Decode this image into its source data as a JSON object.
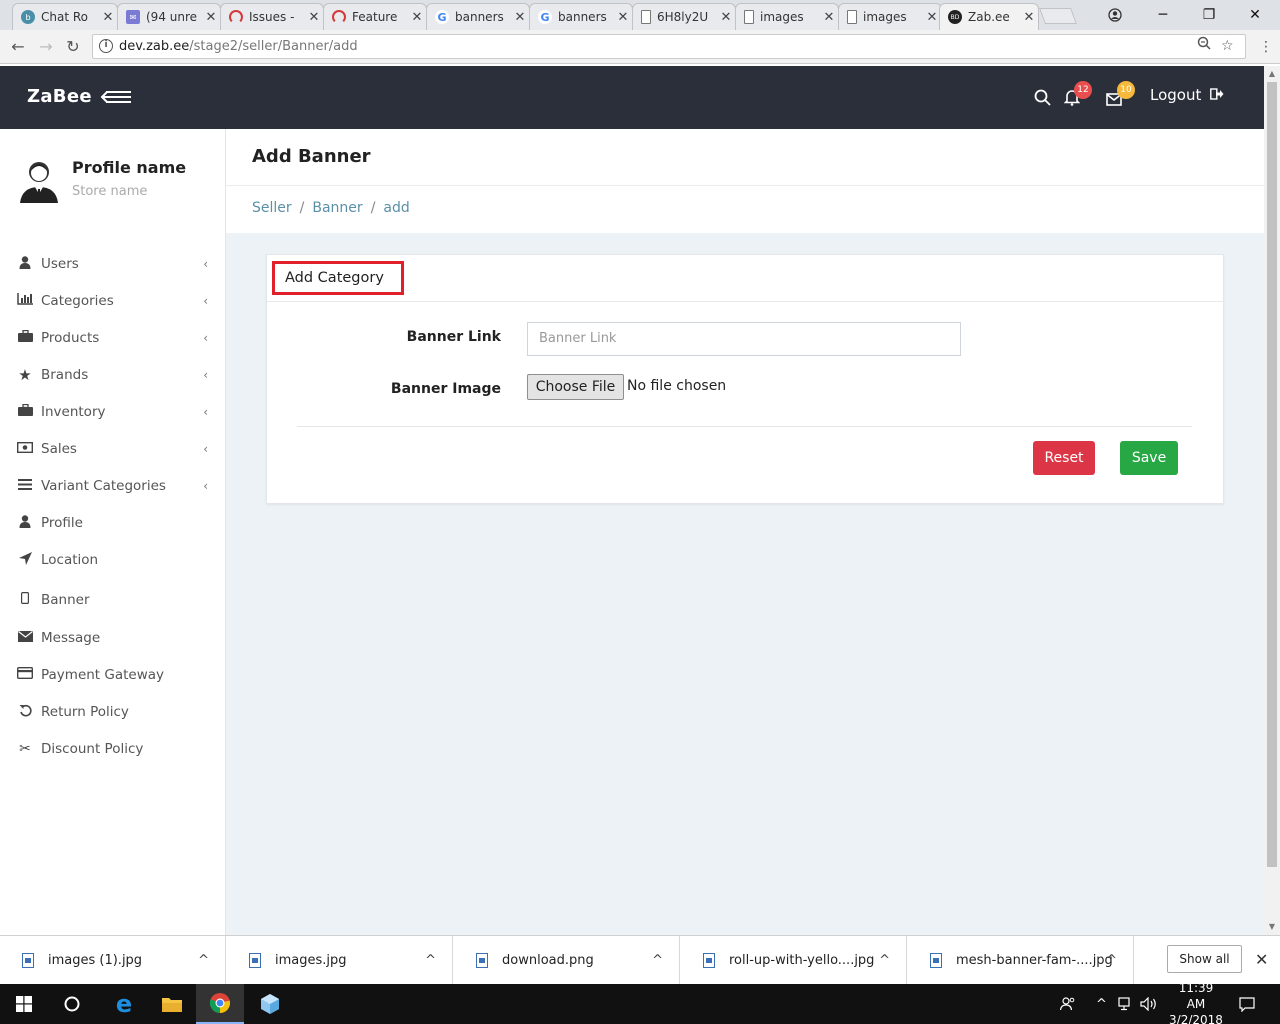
{
  "browser": {
    "tabs": [
      {
        "label": "Chat Ro",
        "icon": "chat-icon"
      },
      {
        "label": "(94 unre",
        "icon": "mail-icon"
      },
      {
        "label": "Issues -",
        "icon": "issues-icon"
      },
      {
        "label": "Feature",
        "icon": "feature-icon"
      },
      {
        "label": "banners",
        "icon": "google-icon"
      },
      {
        "label": "banners",
        "icon": "google-icon"
      },
      {
        "label": "6H8ly2U",
        "icon": "document-icon"
      },
      {
        "label": "images",
        "icon": "document-icon"
      },
      {
        "label": "images",
        "icon": "document-icon"
      },
      {
        "label": "Zab.ee",
        "icon": "zabee-icon"
      }
    ],
    "url_host": "dev.zab.ee",
    "url_path": "/stage2/seller/Banner/add"
  },
  "header": {
    "logo": "ZaBee",
    "notifications_count": "12",
    "messages_count": "10",
    "logout_label": "Logout"
  },
  "sidebar": {
    "profile_name": "Profile name",
    "store_name": "Store name",
    "items": [
      {
        "label": "Users",
        "icon": "user-icon",
        "chevron": true
      },
      {
        "label": "Categories",
        "icon": "bar-chart-icon",
        "chevron": true
      },
      {
        "label": "Products",
        "icon": "briefcase-icon",
        "chevron": true
      },
      {
        "label": "Brands",
        "icon": "star-icon",
        "chevron": true
      },
      {
        "label": "Inventory",
        "icon": "briefcase-icon",
        "chevron": true
      },
      {
        "label": "Sales",
        "icon": "money-icon",
        "chevron": true
      },
      {
        "label": "Variant Categories",
        "icon": "list-icon",
        "chevron": true
      },
      {
        "label": "Profile",
        "icon": "user-icon",
        "chevron": false
      },
      {
        "label": "Location",
        "icon": "location-arrow-icon",
        "chevron": false
      },
      {
        "label": "Banner",
        "icon": "mobile-icon",
        "chevron": false
      },
      {
        "label": "Message",
        "icon": "envelope-icon",
        "chevron": false
      },
      {
        "label": "Payment Gateway",
        "icon": "credit-card-icon",
        "chevron": false
      },
      {
        "label": "Return Policy",
        "icon": "undo-icon",
        "chevron": false
      },
      {
        "label": "Discount Policy",
        "icon": "scissors-icon",
        "chevron": false
      }
    ]
  },
  "page": {
    "title": "Add Banner",
    "breadcrumb": [
      "Seller",
      "Banner",
      "add"
    ]
  },
  "form": {
    "card_title": "Add Category",
    "banner_link_label": "Banner Link",
    "banner_link_placeholder": "Banner Link",
    "banner_image_label": "Banner Image",
    "choose_file_label": "Choose File",
    "no_file_text": "No file chosen",
    "reset_label": "Reset",
    "save_label": "Save",
    "colors": {
      "reset": "#dc3545",
      "save": "#28a745"
    }
  },
  "downloads": {
    "items": [
      "images (1).jpg",
      "images.jpg",
      "download.png",
      "roll-up-with-yello....jpg",
      "mesh-banner-fam-....jpg"
    ],
    "show_all_label": "Show all"
  },
  "taskbar": {
    "time": "11:39 AM",
    "date": "3/2/2018"
  }
}
